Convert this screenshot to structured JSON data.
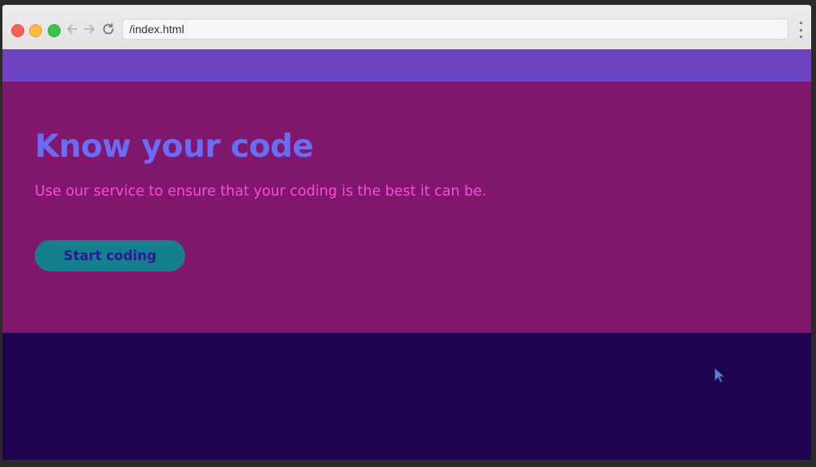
{
  "browser": {
    "url": "/index.html"
  },
  "hero": {
    "title": "Know your code",
    "subtitle": "Use our service to ensure that your coding is the best it can be.",
    "cta_label": "Start coding"
  },
  "colors": {
    "topbar": "#6f42c1",
    "hero_bg": "#81166d",
    "footer_bg": "#1e044e",
    "title": "#6a6cf6",
    "subtitle": "#f54fd6",
    "cta_bg": "#15808d",
    "cta_text": "#2f1795"
  },
  "icons": [
    "close-dot",
    "minimize-dot",
    "maximize-dot",
    "back-arrow-icon",
    "forward-arrow-icon",
    "reload-icon",
    "menu-dots-icon",
    "mouse-cursor-icon"
  ]
}
